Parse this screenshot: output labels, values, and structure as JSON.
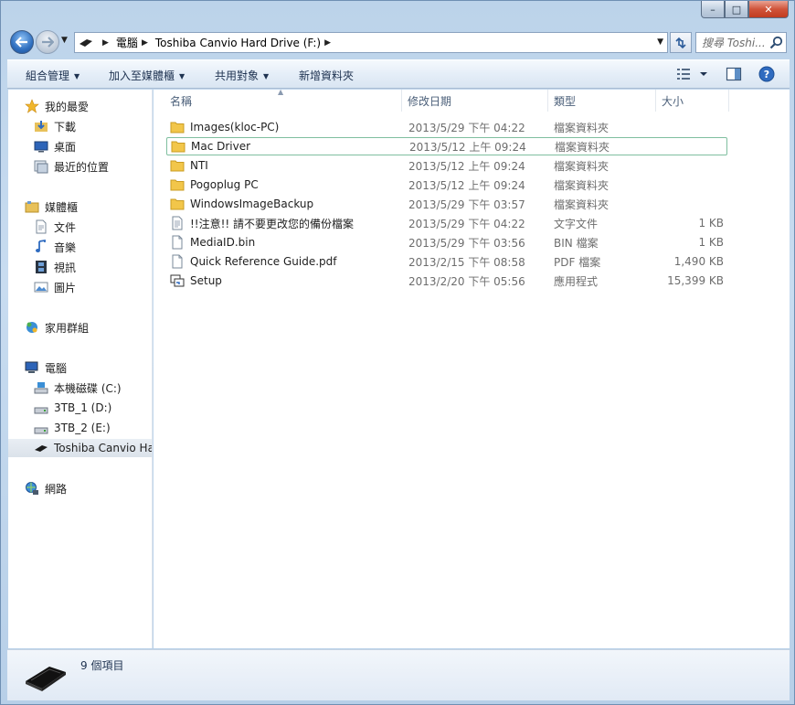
{
  "window": {
    "minimize_glyph": "–",
    "maximize_glyph": "□",
    "close_glyph": "✕"
  },
  "address_bar": {
    "crumbs": [
      "電腦",
      "Toshiba Canvio Hard Drive (F:)"
    ],
    "search_placeholder": "搜尋 Toshi..."
  },
  "toolbar": {
    "organize": "組合管理",
    "include_in_library": "加入至媒體櫃",
    "share_with": "共用對象",
    "new_folder": "新增資料夾"
  },
  "sidebar": {
    "favorites": {
      "label": "我的最愛",
      "items": [
        "下載",
        "桌面",
        "最近的位置"
      ]
    },
    "libraries": {
      "label": "媒體櫃",
      "items": [
        "文件",
        "音樂",
        "視訊",
        "圖片"
      ]
    },
    "homegroup": {
      "label": "家用群組"
    },
    "computer": {
      "label": "電腦",
      "items": [
        "本機磁碟 (C:)",
        "3TB_1 (D:)",
        "3TB_2 (E:)",
        "Toshiba Canvio Hard Drive (F:)"
      ]
    },
    "network": {
      "label": "網路"
    }
  },
  "columns": {
    "name": "名稱",
    "date_modified": "修改日期",
    "type": "類型",
    "size": "大小"
  },
  "files": [
    {
      "name": "Images(kloc-PC)",
      "date": "2013/5/29 下午 04:22",
      "type": "檔案資料夾",
      "size": "",
      "icon": "folder-icon"
    },
    {
      "name": "Mac Driver",
      "date": "2013/5/12 上午 09:24",
      "type": "檔案資料夾",
      "size": "",
      "icon": "folder-icon"
    },
    {
      "name": "NTI",
      "date": "2013/5/12 上午 09:24",
      "type": "檔案資料夾",
      "size": "",
      "icon": "folder-icon"
    },
    {
      "name": "Pogoplug PC",
      "date": "2013/5/12 上午 09:24",
      "type": "檔案資料夾",
      "size": "",
      "icon": "folder-icon"
    },
    {
      "name": "WindowsImageBackup",
      "date": "2013/5/29 下午 03:57",
      "type": "檔案資料夾",
      "size": "",
      "icon": "folder-icon"
    },
    {
      "name": "!!注意!! 請不要更改您的備份檔案",
      "date": "2013/5/29 下午 04:22",
      "type": "文字文件",
      "size": "1 KB",
      "icon": "text-file-icon"
    },
    {
      "name": "MediaID.bin",
      "date": "2013/5/29 下午 03:56",
      "type": "BIN 檔案",
      "size": "1 KB",
      "icon": "file-icon"
    },
    {
      "name": "Quick Reference Guide.pdf",
      "date": "2013/2/15 下午 08:58",
      "type": "PDF 檔案",
      "size": "1,490 KB",
      "icon": "file-icon"
    },
    {
      "name": "Setup",
      "date": "2013/2/20 下午 05:56",
      "type": "應用程式",
      "size": "15,399 KB",
      "icon": "setup-app-icon"
    }
  ],
  "status": {
    "item_count": "9 個項目"
  },
  "colors": {
    "folder": "#f2c64a",
    "selection_border": "#7fbf9f",
    "header_text": "#4c607a",
    "detail_text": "#6d6d6d"
  }
}
